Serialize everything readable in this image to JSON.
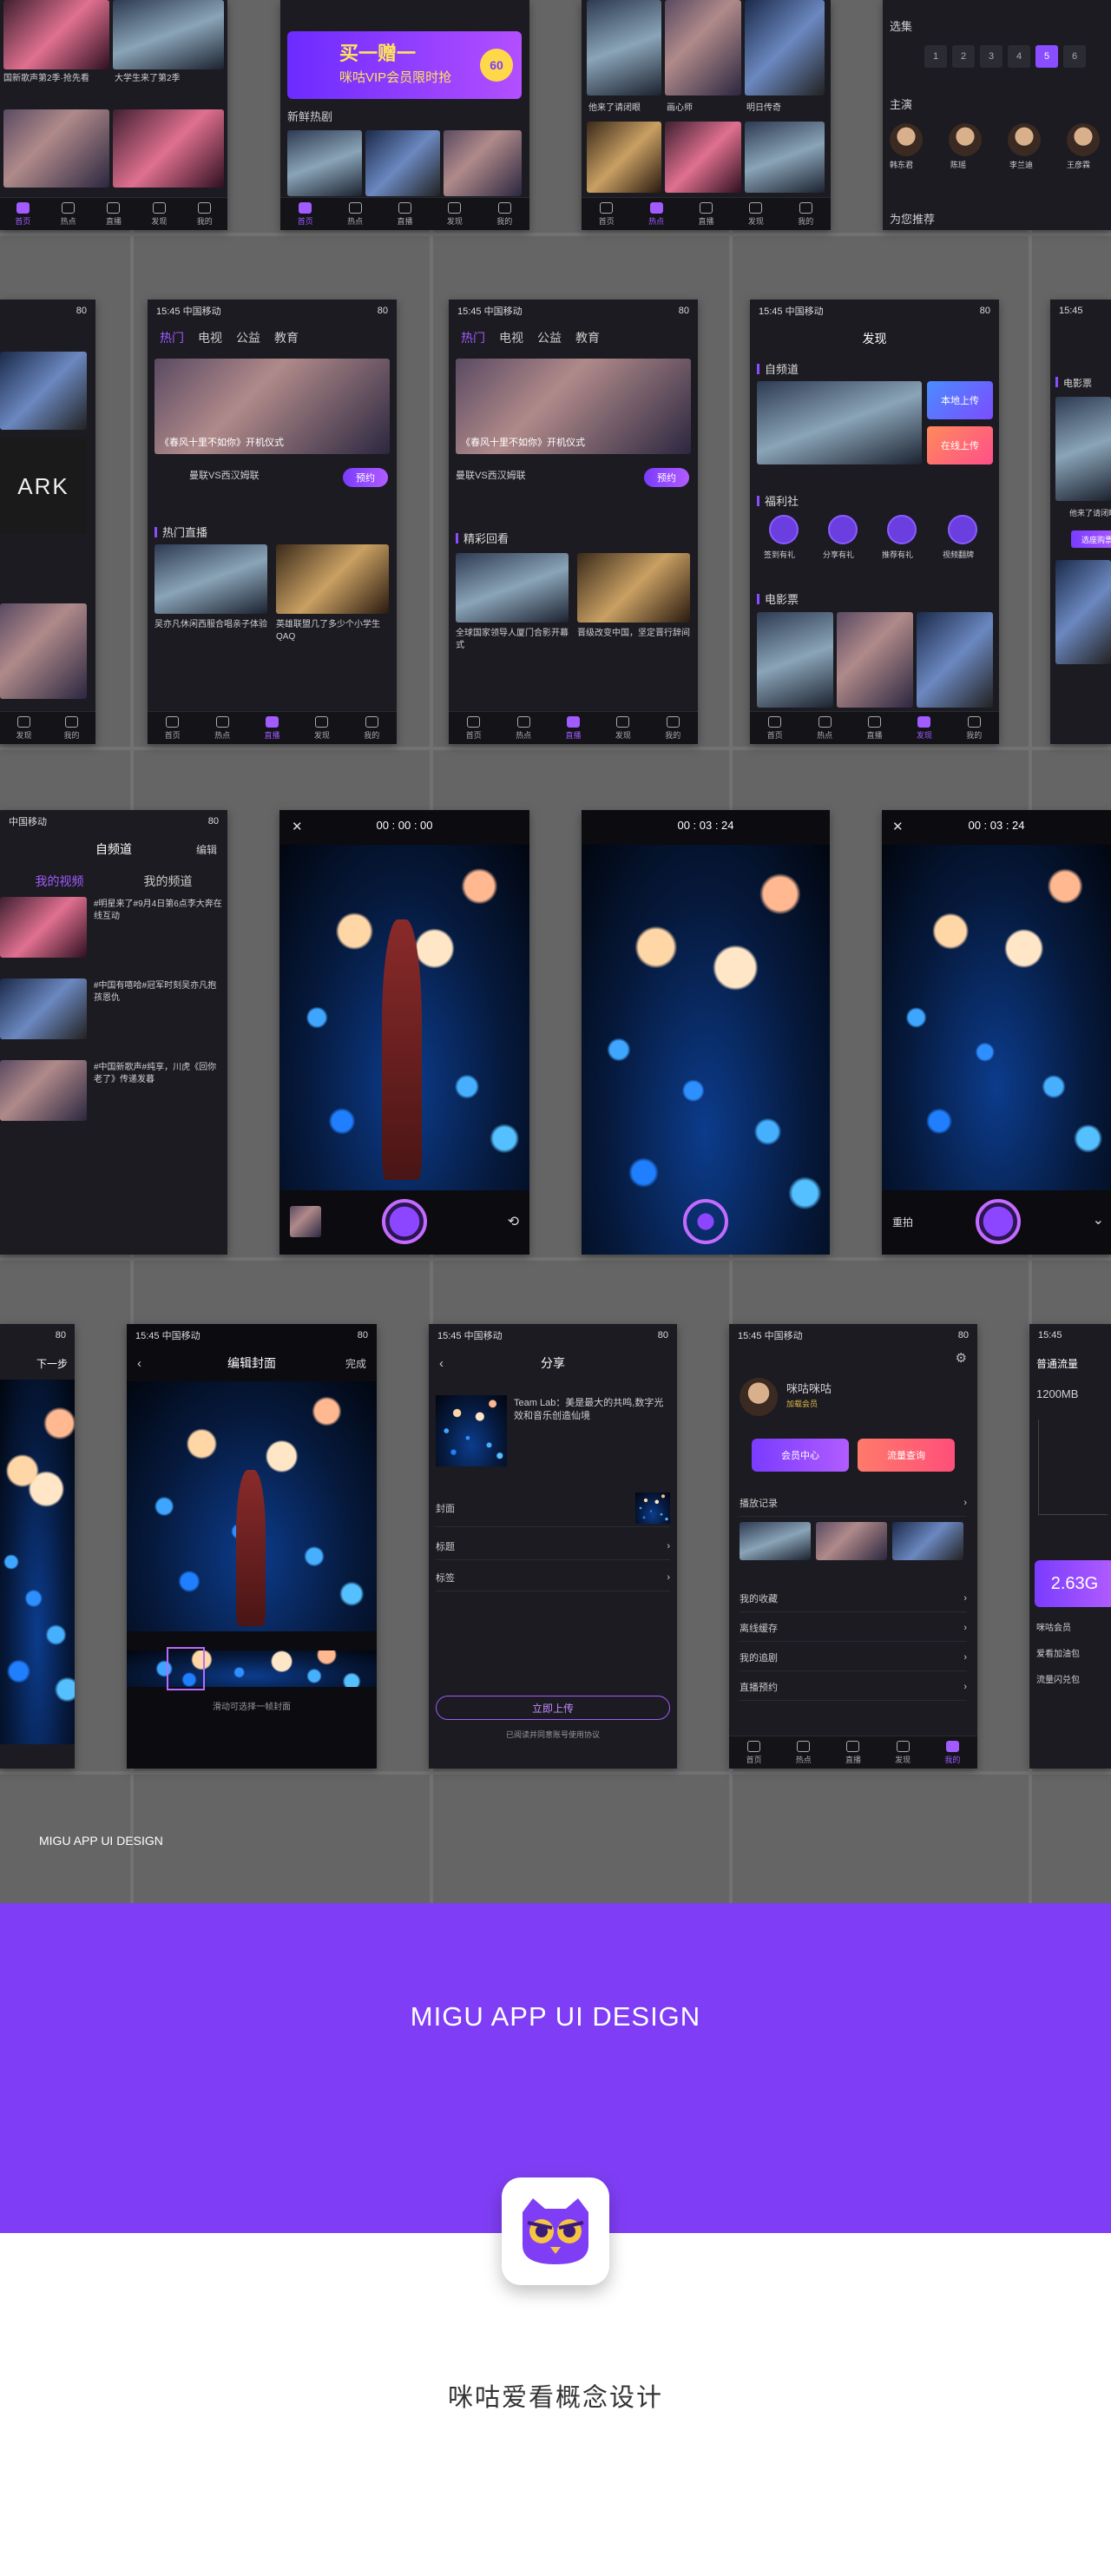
{
  "status": {
    "time": "15:45",
    "carrier": "中国移动",
    "battery": "80"
  },
  "tabbar": [
    "首页",
    "热点",
    "直播",
    "发现",
    "我的"
  ],
  "row1": {
    "p1": {
      "captions": [
        "国新歌声第2季·抢先看",
        "大学生来了第2季"
      ]
    },
    "p2": {
      "banner": "买一赠一",
      "banner_sub": "咪咕VIP会员限时抢",
      "badge": "60",
      "section": "新鲜热剧"
    },
    "p3": {
      "captions": [
        "他来了请闭眼",
        "画心师",
        "明日传奇"
      ]
    },
    "p4": {
      "select_label": "选集",
      "episodes": [
        "1",
        "2",
        "3",
        "4",
        "5",
        "6"
      ],
      "cast_label": "主演",
      "cast": [
        "韩东君",
        "陈瑶",
        "李兰迪",
        "王彦霖"
      ],
      "recommend": "为您推荐"
    }
  },
  "row2": {
    "p1": {
      "text": "ARK"
    },
    "p2": {
      "tabs": [
        "热门",
        "电视",
        "公益",
        "教育"
      ],
      "banner_caption": "《春风十里不如你》开机仪式",
      "event": "曼联VS西汉姆联",
      "reserve": "预约",
      "section": "热门直播",
      "cards": [
        "吴亦凡休闲西服合唱亲子体验",
        "英雄联盟几了多少个小学生 QAQ"
      ]
    },
    "p3": {
      "tabs": [
        "热门",
        "电视",
        "公益",
        "教育"
      ],
      "banner_caption": "《春风十里不如你》开机仪式",
      "event": "曼联VS西汉姆联",
      "reserve": "预约",
      "section": "精彩回看",
      "cards": [
        "全球国家领导人厦门合影开幕式",
        "晋级改变中国，坚定晋行辞间"
      ]
    },
    "p4": {
      "title": "发现",
      "sec1": "自频道",
      "btn1": "本地上传",
      "btn2": "在线上传",
      "sec2": "福利社",
      "icons": [
        "签到有礼",
        "分享有礼",
        "推荐有礼",
        "视频翻牌"
      ],
      "sec3": "电影票"
    },
    "p5": {
      "sec": "电影票",
      "caption": "他来了请闭眼",
      "reserve": "选座购票"
    }
  },
  "row3": {
    "p1": {
      "title": "自频道",
      "edit": "编辑",
      "tabs": [
        "我的视频",
        "我的频道"
      ],
      "items": [
        "#明星来了#9月4日第6点李大奔在线互动",
        "#中国有嘻哈#冠军时刻吴亦凡抱孩恩仇",
        "#中国新歌声#纯享，川虎《回你老了》传递发暮"
      ]
    },
    "p2": {
      "timer": "00 : 00 : 00"
    },
    "p3": {
      "timer": "00 : 03 : 24"
    },
    "p4": {
      "timer": "00 : 03 : 24",
      "retake": "重拍"
    }
  },
  "row4": {
    "p1": {
      "next": "下一步"
    },
    "p2": {
      "title": "编辑封面",
      "done": "完成",
      "hint": "滑动可选择一帧封面"
    },
    "p3": {
      "title": "分享",
      "desc": "Team Lab：美是最大的共鸣,数字光效和音乐创造仙境",
      "fields": [
        "封面",
        "标题",
        "标签"
      ],
      "upload": "立即上传",
      "agree": "已阅读并同意账号使用协议"
    },
    "p4": {
      "user": "咪咕咪咕",
      "level": "加载会员",
      "btn1": "会员中心",
      "btn2": "流量查询",
      "menu": [
        "播放记录",
        "我的收藏",
        "离线缓存",
        "我的追剧",
        "直播预约"
      ]
    },
    "p5": {
      "title": "普通流量",
      "data": "1200MB",
      "big": "2.63G",
      "menu": [
        "咪咕会员",
        "爱看加油包",
        "流量闪兑包"
      ]
    }
  },
  "caption": "MIGU APP UI DESIGN",
  "footer": {
    "title": "MIGU APP UI DESIGN",
    "subtitle": "咪咕爱看概念设计",
    "accent": "#7f3ef5"
  }
}
